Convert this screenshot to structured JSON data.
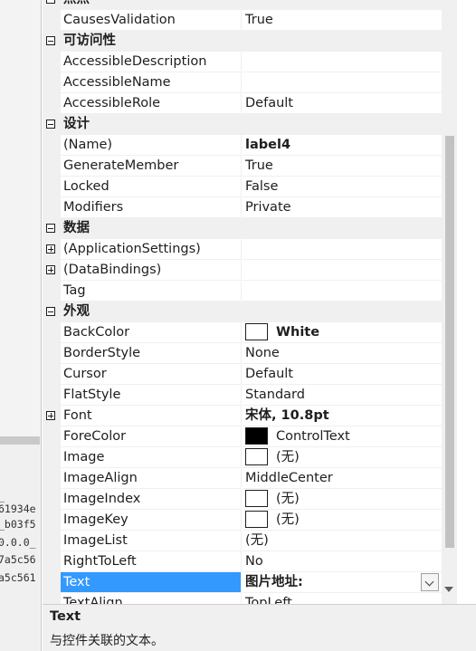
{
  "left_panel": {
    "hex_lines": [
      "_",
      "61934e",
      "_b03f5",
      "0.0.0_",
      "7a5c56",
      "a5c561"
    ]
  },
  "categories": {
    "behavior": "点点",
    "accessibility": "可访问性",
    "design": "设计",
    "data": "数据",
    "appearance": "外观"
  },
  "properties": {
    "causes_validation": {
      "name": "CausesValidation",
      "value": "True"
    },
    "accessible_description": {
      "name": "AccessibleDescription",
      "value": ""
    },
    "accessible_name": {
      "name": "AccessibleName",
      "value": ""
    },
    "accessible_role": {
      "name": "AccessibleRole",
      "value": "Default"
    },
    "name": {
      "name": "(Name)",
      "value": "label4"
    },
    "generate_member": {
      "name": "GenerateMember",
      "value": "True"
    },
    "locked": {
      "name": "Locked",
      "value": "False"
    },
    "modifiers": {
      "name": "Modifiers",
      "value": "Private"
    },
    "application_settings": {
      "name": "(ApplicationSettings)",
      "value": ""
    },
    "data_bindings": {
      "name": "(DataBindings)",
      "value": ""
    },
    "tag": {
      "name": "Tag",
      "value": ""
    },
    "back_color": {
      "name": "BackColor",
      "value": "White",
      "swatch": "#ffffff"
    },
    "border_style": {
      "name": "BorderStyle",
      "value": "None"
    },
    "cursor": {
      "name": "Cursor",
      "value": "Default"
    },
    "flat_style": {
      "name": "FlatStyle",
      "value": "Standard"
    },
    "font": {
      "name": "Font",
      "value": "宋体, 10.8pt"
    },
    "fore_color": {
      "name": "ForeColor",
      "value": "ControlText",
      "swatch": "#000000"
    },
    "image": {
      "name": "Image",
      "value": "(无)",
      "swatch": "#ffffff"
    },
    "image_align": {
      "name": "ImageAlign",
      "value": "MiddleCenter"
    },
    "image_index": {
      "name": "ImageIndex",
      "value": "(无)",
      "swatch": "#ffffff"
    },
    "image_key": {
      "name": "ImageKey",
      "value": "(无)",
      "swatch": "#ffffff"
    },
    "image_list": {
      "name": "ImageList",
      "value": "(无)"
    },
    "right_to_left": {
      "name": "RightToLeft",
      "value": "No"
    },
    "text": {
      "name": "Text",
      "value": "图片地址:"
    },
    "text_align": {
      "name": "TextAlign",
      "value": "TopLeft"
    }
  },
  "description": {
    "title": "Text",
    "text": "与控件关联的文本。"
  },
  "colors": {
    "selection": "#3399ff",
    "category_bg": "#f0f0f0",
    "scroll_thumb": "#c2c2c2"
  }
}
